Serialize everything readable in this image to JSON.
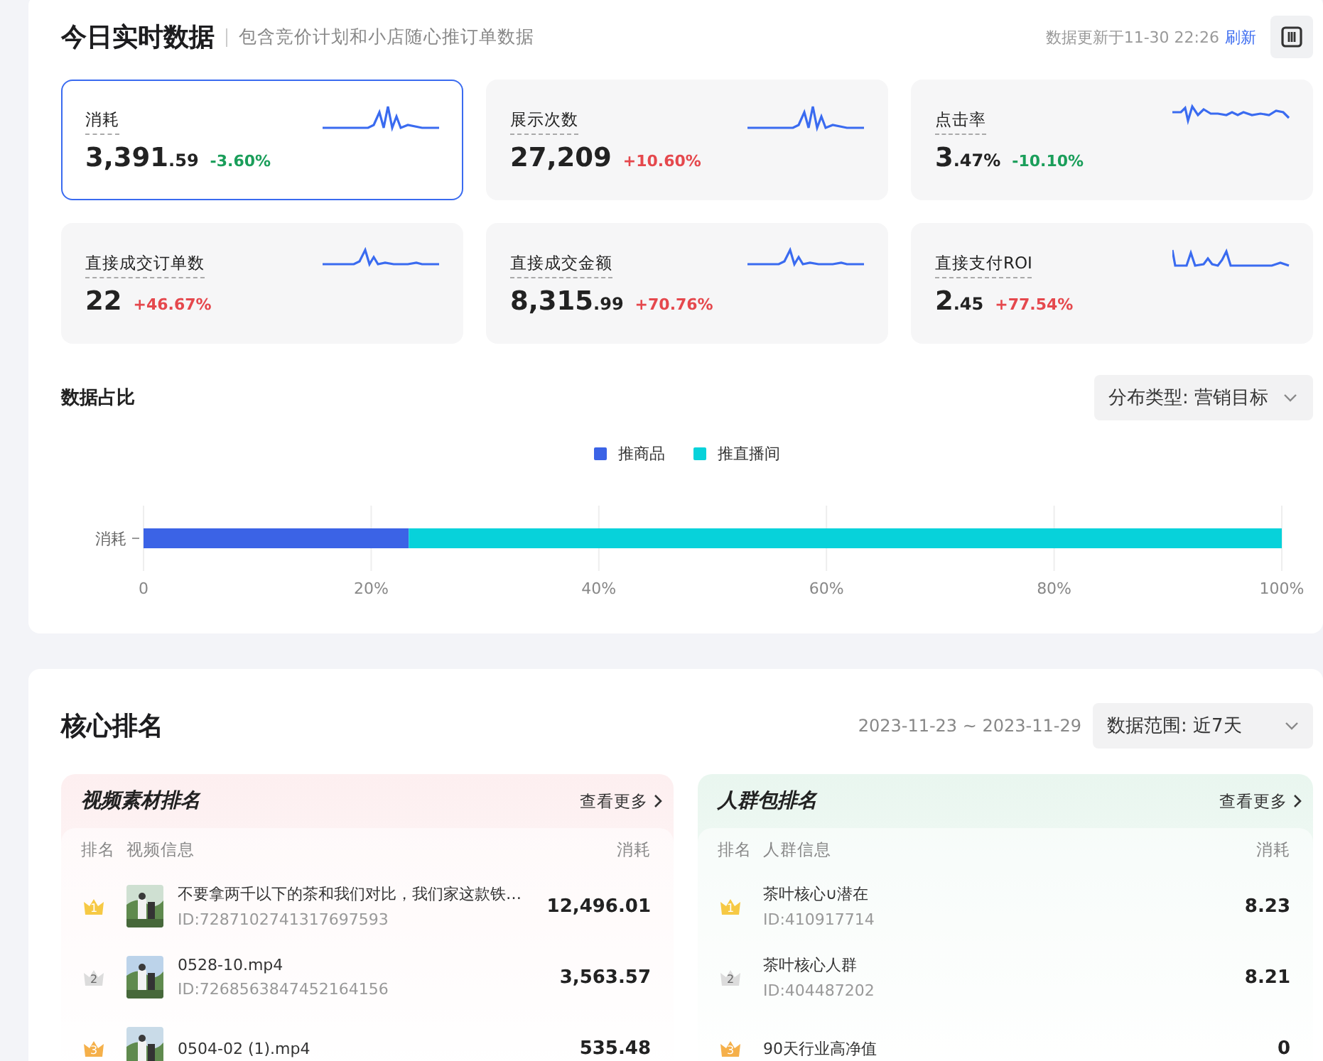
{
  "header": {
    "title": "今日实时数据",
    "subtitle": "包含竞价计划和小店随心推订单数据",
    "updated": "数据更新于11-30 22:26",
    "refresh": "刷新"
  },
  "metrics": [
    {
      "label": "消耗",
      "value": "3,391",
      "fraction": ".59",
      "change": "-3.60%",
      "color": "#1a9e5a",
      "selected": true
    },
    {
      "label": "展示次数",
      "value": "27,209",
      "change": "+10.60%",
      "color": "#e5484d",
      "selected": false
    },
    {
      "label": "点击率",
      "value": "3",
      "fraction": ".47%",
      "change": "-10.10%",
      "color": "#1a9e5a",
      "selected": false
    },
    {
      "label": "直接成交订单数",
      "value": "22",
      "change": "+46.67%",
      "color": "#e5484d",
      "selected": false
    },
    {
      "label": "直接成交金额",
      "value": "8,315",
      "fraction": ".99",
      "change": "+70.76%",
      "color": "#e5484d",
      "selected": false
    },
    {
      "label": "直接支付ROI",
      "value": "2",
      "fraction": ".45",
      "change": "+77.54%",
      "color": "#e5484d",
      "selected": false
    }
  ],
  "distribution": {
    "title": "数据占比",
    "dropdown": "分布类型: 营销目标",
    "chart_data": {
      "type": "bar",
      "orientation": "horizontal",
      "stacked": true,
      "categories": [
        "消耗"
      ],
      "series": [
        {
          "name": "推商品",
          "color": "#3b63e6",
          "values": [
            23.3
          ]
        },
        {
          "name": "推直播间",
          "color": "#07d2da",
          "values": [
            76.7
          ]
        }
      ],
      "grid": true,
      "legend": true,
      "xlim": [
        0,
        100
      ],
      "xticks": [
        {
          "value": 0,
          "label": "0"
        },
        {
          "value": 20,
          "label": "20%"
        },
        {
          "value": 40,
          "label": "40%"
        },
        {
          "value": 60,
          "label": "60%"
        },
        {
          "value": 80,
          "label": "80%"
        },
        {
          "value": 100,
          "label": "100%"
        }
      ]
    }
  },
  "ranking": {
    "title": "核心排名",
    "date_range": "2023-11-23 ~ 2023-11-29",
    "range_dropdown": "数据范围: 近7天",
    "panels": [
      {
        "kind": "video",
        "title": "视频素材排名",
        "more": "查看更多",
        "columns": [
          "排名",
          "视频信息",
          "消耗"
        ],
        "rows": [
          {
            "rank": "1",
            "name": "不要拿两千以下的茶和我们对比，我们家这款铁…",
            "id": "ID:7287102741317697593",
            "value": "12,496.01"
          },
          {
            "rank": "2",
            "name": "0528-10.mp4",
            "id": "ID:7268563847452164156",
            "value": "3,563.57"
          },
          {
            "rank": "3",
            "name": "0504-02 (1).mp4",
            "value": "535.48"
          }
        ]
      },
      {
        "kind": "audience",
        "title": "人群包排名",
        "more": "查看更多",
        "columns": [
          "排名",
          "人群信息",
          "消耗"
        ],
        "rows": [
          {
            "rank": "1",
            "name": "茶叶核心∪潜在",
            "id": "ID:410917714",
            "value": "8.23"
          },
          {
            "rank": "2",
            "name": "茶叶核心人群",
            "id": "ID:404487202",
            "value": "8.21"
          },
          {
            "rank": "3",
            "name": "90天行业高净值",
            "value": "0"
          }
        ]
      }
    ]
  }
}
